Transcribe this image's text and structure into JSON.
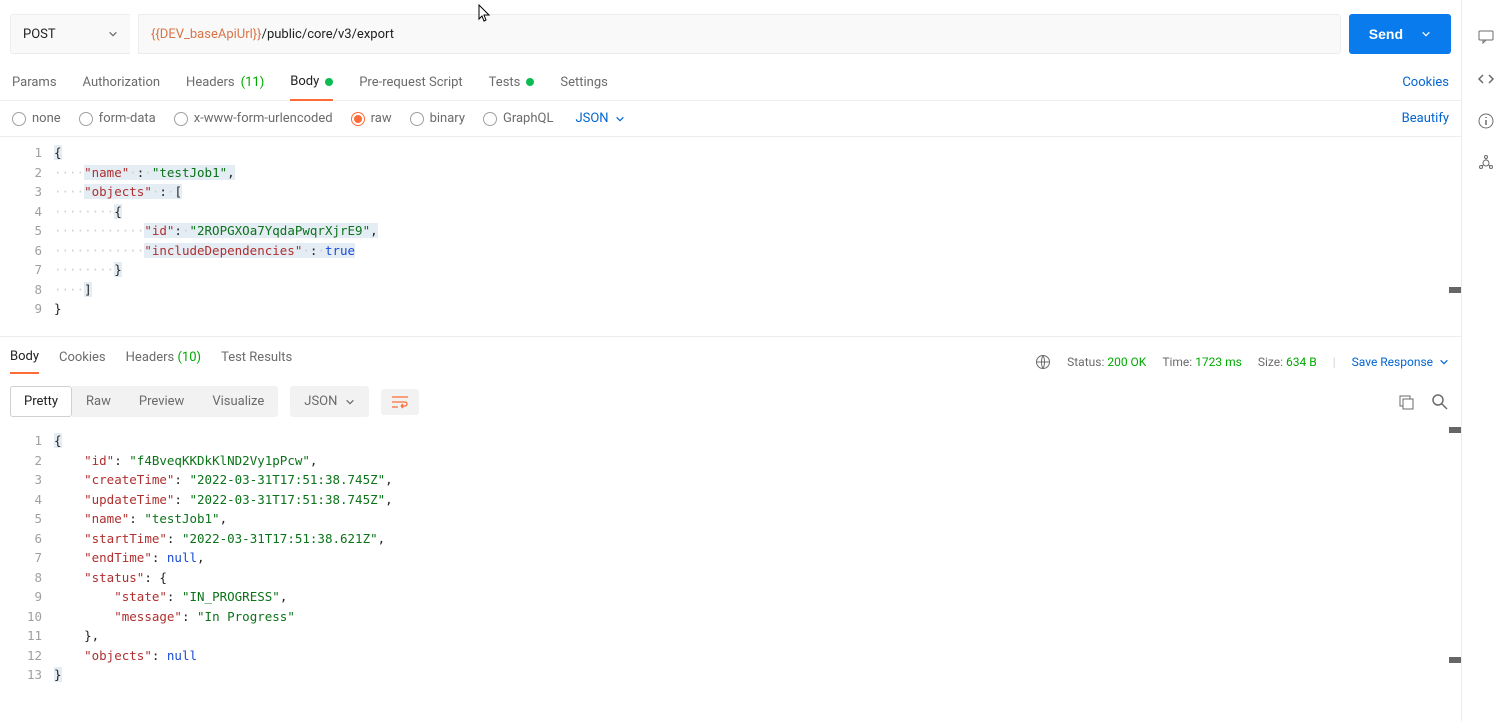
{
  "request": {
    "method": "POST",
    "url_var": "{{DEV_baseApiUrl}}",
    "url_path": "/public/core/v3/export",
    "send_label": "Send"
  },
  "tabs": {
    "params": "Params",
    "authorization": "Authorization",
    "headers": "Headers",
    "headers_count": "(11)",
    "body": "Body",
    "prerequest": "Pre-request Script",
    "tests": "Tests",
    "settings": "Settings",
    "cookies": "Cookies"
  },
  "body_types": {
    "none": "none",
    "formdata": "form-data",
    "xwww": "x-www-form-urlencoded",
    "raw": "raw",
    "binary": "binary",
    "graphql": "GraphQL",
    "json": "JSON",
    "beautify": "Beautify"
  },
  "request_body": {
    "line_numbers": [
      "1",
      "2",
      "3",
      "4",
      "5",
      "6",
      "7",
      "8",
      "9"
    ],
    "name_key": "\"name\"",
    "name_val": "\"testJob1\"",
    "objects_key": "\"objects\"",
    "id_key": "\"id\"",
    "id_val": "\"2ROPGXOa7YqdaPwqrXjrE9\"",
    "include_key": "\"includeDependencies\"",
    "include_val": "true"
  },
  "response_tabs": {
    "body": "Body",
    "cookies": "Cookies",
    "headers": "Headers",
    "headers_count": "(10)",
    "test_results": "Test Results",
    "status_label": "Status:",
    "status_val": "200 OK",
    "time_label": "Time:",
    "time_val": "1723 ms",
    "size_label": "Size:",
    "size_val": "634 B",
    "save": "Save Response"
  },
  "view": {
    "pretty": "Pretty",
    "raw": "Raw",
    "preview": "Preview",
    "visualize": "Visualize",
    "json": "JSON"
  },
  "response_body": {
    "line_numbers": [
      "1",
      "2",
      "3",
      "4",
      "5",
      "6",
      "7",
      "8",
      "9",
      "10",
      "11",
      "12",
      "13"
    ],
    "id_key": "\"id\"",
    "id_val": "\"f4BveqKKDkKlND2Vy1pPcw\"",
    "create_key": "\"createTime\"",
    "create_val": "\"2022-03-31T17:51:38.745Z\"",
    "update_key": "\"updateTime\"",
    "update_val": "\"2022-03-31T17:51:38.745Z\"",
    "name_key": "\"name\"",
    "name_val": "\"testJob1\"",
    "start_key": "\"startTime\"",
    "start_val": "\"2022-03-31T17:51:38.621Z\"",
    "end_key": "\"endTime\"",
    "end_val": "null",
    "status_key": "\"status\"",
    "state_key": "\"state\"",
    "state_val": "\"IN_PROGRESS\"",
    "message_key": "\"message\"",
    "message_val": "\"In Progress\"",
    "objects_key": "\"objects\"",
    "objects_val": "null"
  }
}
